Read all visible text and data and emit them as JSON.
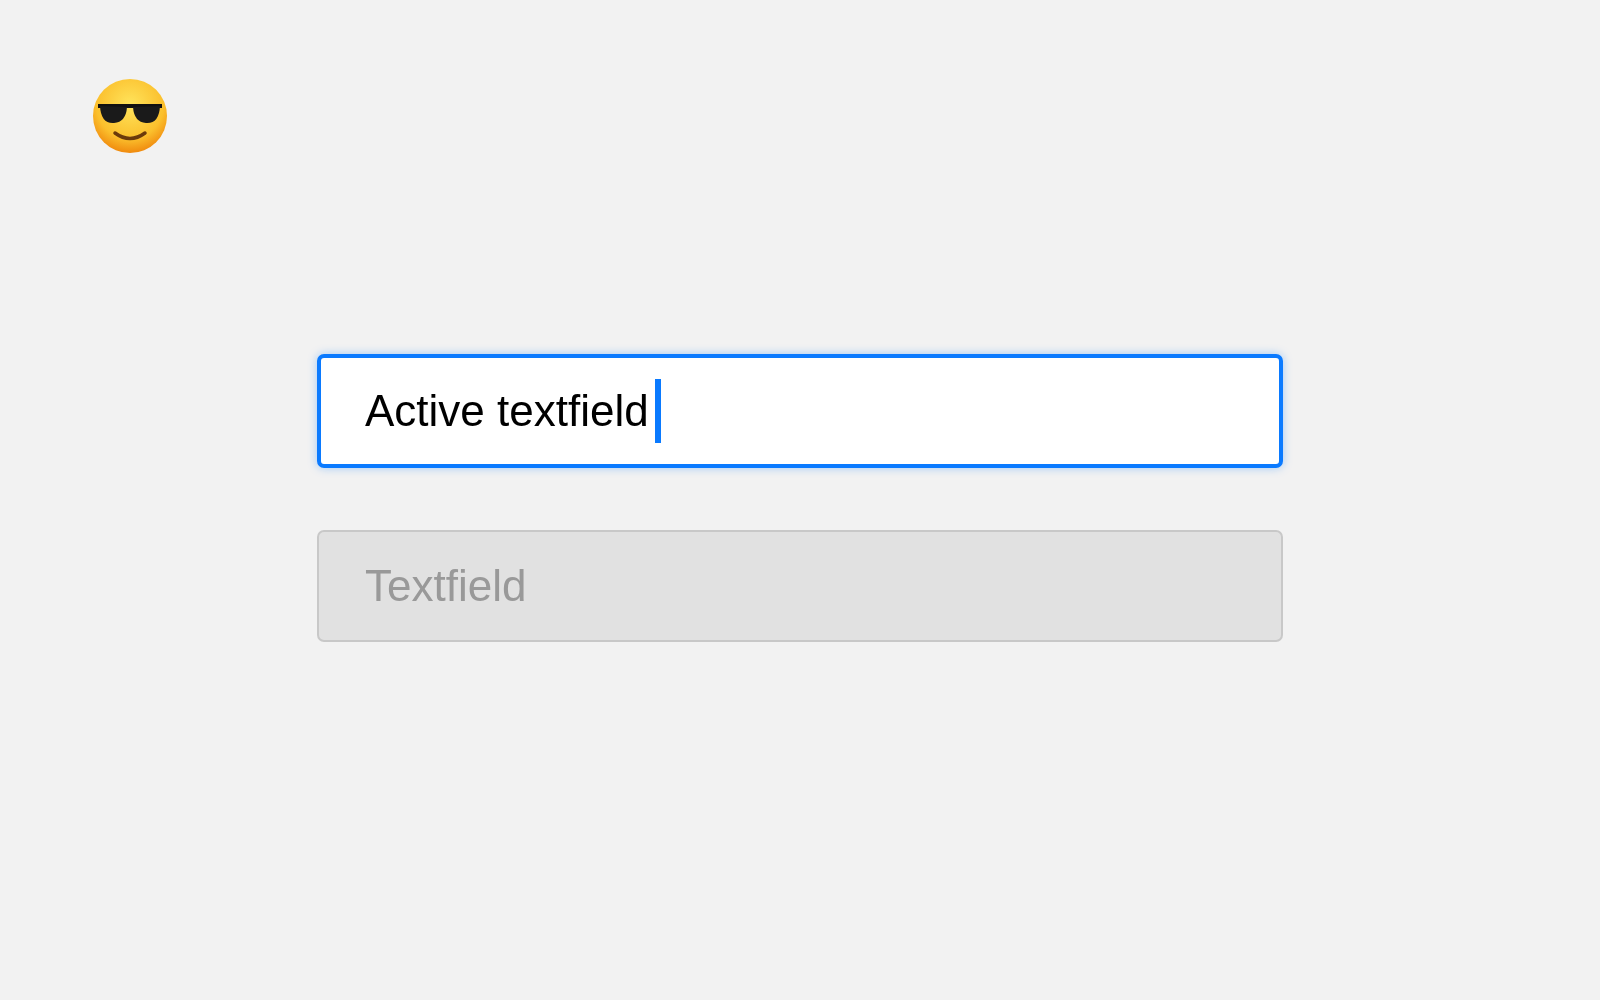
{
  "fields": [
    {
      "value": "Active textfield",
      "focused": true,
      "disabled": false
    },
    {
      "placeholder": "Textfield",
      "focused": false,
      "disabled": true
    }
  ]
}
